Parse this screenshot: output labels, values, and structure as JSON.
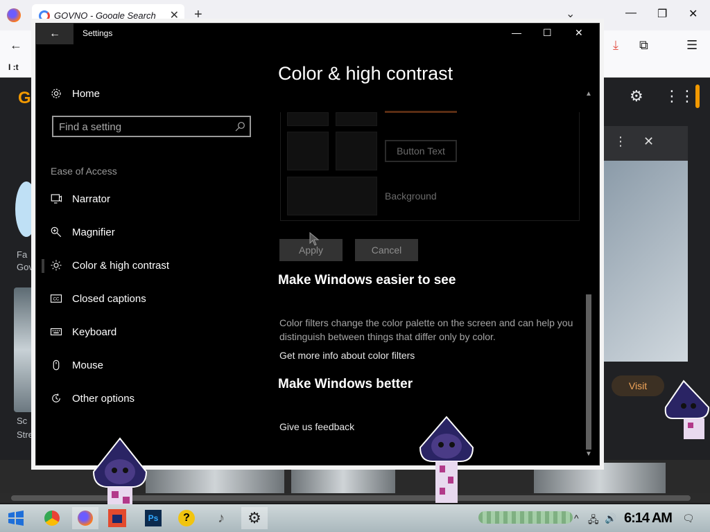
{
  "browser": {
    "tab_title": "GOVNO - Google Search",
    "new_tab": "+",
    "bookmark": "I :t",
    "google_letter": "G",
    "visit_label": "Visit",
    "left_texts": [
      "Fa",
      "Gov",
      "Sc",
      "Stre"
    ]
  },
  "settings": {
    "window_title": "Settings",
    "search_placeholder": "Find a setting",
    "home_label": "Home",
    "section_label": "Ease of Access",
    "nav_items": [
      {
        "label": "Narrator",
        "icon": "narrator-icon"
      },
      {
        "label": "Magnifier",
        "icon": "magnifier-icon"
      },
      {
        "label": "Color & high contrast",
        "icon": "brightness-icon"
      },
      {
        "label": "Closed captions",
        "icon": "closed-captions-icon"
      },
      {
        "label": "Keyboard",
        "icon": "keyboard-icon"
      },
      {
        "label": "Mouse",
        "icon": "mouse-icon"
      },
      {
        "label": "Other options",
        "icon": "other-options-icon"
      }
    ],
    "selected_nav": "Color & high contrast",
    "page_title": "Color & high contrast",
    "preview": {
      "button_text": "Button Text",
      "background_label": "Background"
    },
    "apply_label": "Apply",
    "cancel_label": "Cancel",
    "section1_title": "Make Windows easier to see",
    "section1_desc": "Color filters change the color palette on the screen and can help you distinguish between things that differ only by color.",
    "section1_link": "Get more info about color filters",
    "section2_title": "Make Windows better",
    "section2_link": "Give us feedback"
  },
  "taskbar": {
    "clock": "6:14 AM"
  },
  "colors": {
    "settings_bg": "#000000",
    "accent_orange": "#f2a65a",
    "taskbar": "#b9c8cc"
  }
}
